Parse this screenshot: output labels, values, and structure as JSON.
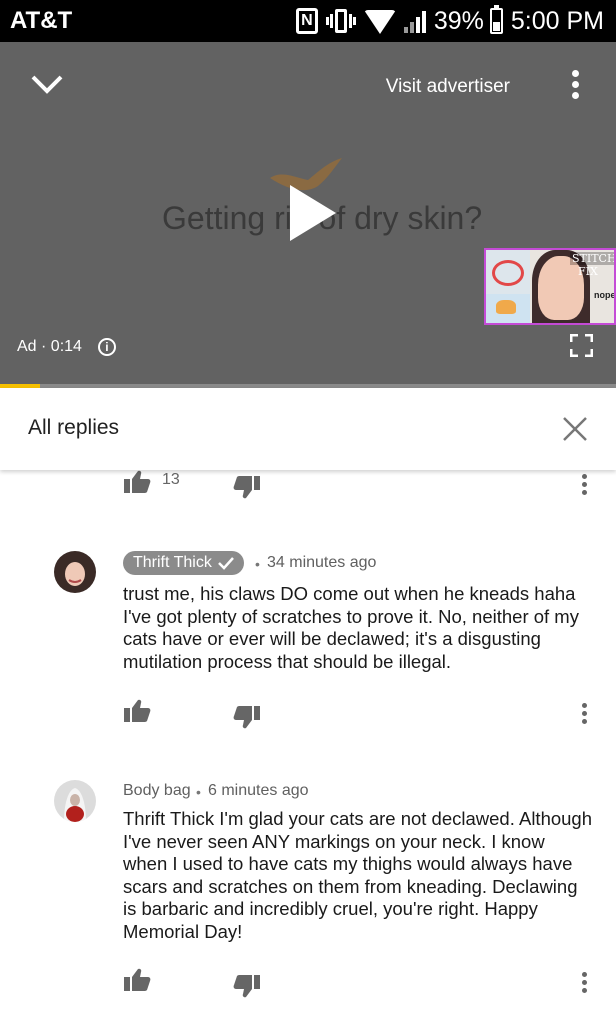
{
  "status_bar": {
    "carrier": "AT&T",
    "nfc_glyph": "N",
    "battery": "39%",
    "time": "5:00 PM"
  },
  "video": {
    "visit_advertiser": "Visit advertiser",
    "headline": "Getting rid of dry skin?",
    "ad_label": "Ad · 0:14",
    "progress_pct": 6.5,
    "thumbnail": {
      "title_line1": "STITCH",
      "title_line2": "FIX",
      "caption": "nope."
    }
  },
  "replies_panel": {
    "title": "All replies"
  },
  "comments": [
    {
      "like_count": "13"
    },
    {
      "author": "Thrift Thick",
      "verified": true,
      "separator": "•",
      "time": "34 minutes ago",
      "text": "trust me, his claws DO come out when he kneads haha I've got plenty of scratches to prove it. No, neither of my cats have or ever will be declawed; it's a disgusting mutilation process that should be illegal."
    },
    {
      "author": "Body bag",
      "verified": false,
      "separator": "•",
      "time": "6 minutes ago",
      "text": "Thrift Thick I'm glad your cats are not declawed. Although I've never seen ANY markings on your neck. I know when I used to have cats my thighs would always have scars and scratches on them from kneading. Declawing is barbaric and incredibly cruel, you're right. Happy Memorial Day!"
    }
  ],
  "colors": {
    "accent_progress": "#f5c000",
    "video_bg": "#626262",
    "chip_bg": "#8b8b8b"
  }
}
